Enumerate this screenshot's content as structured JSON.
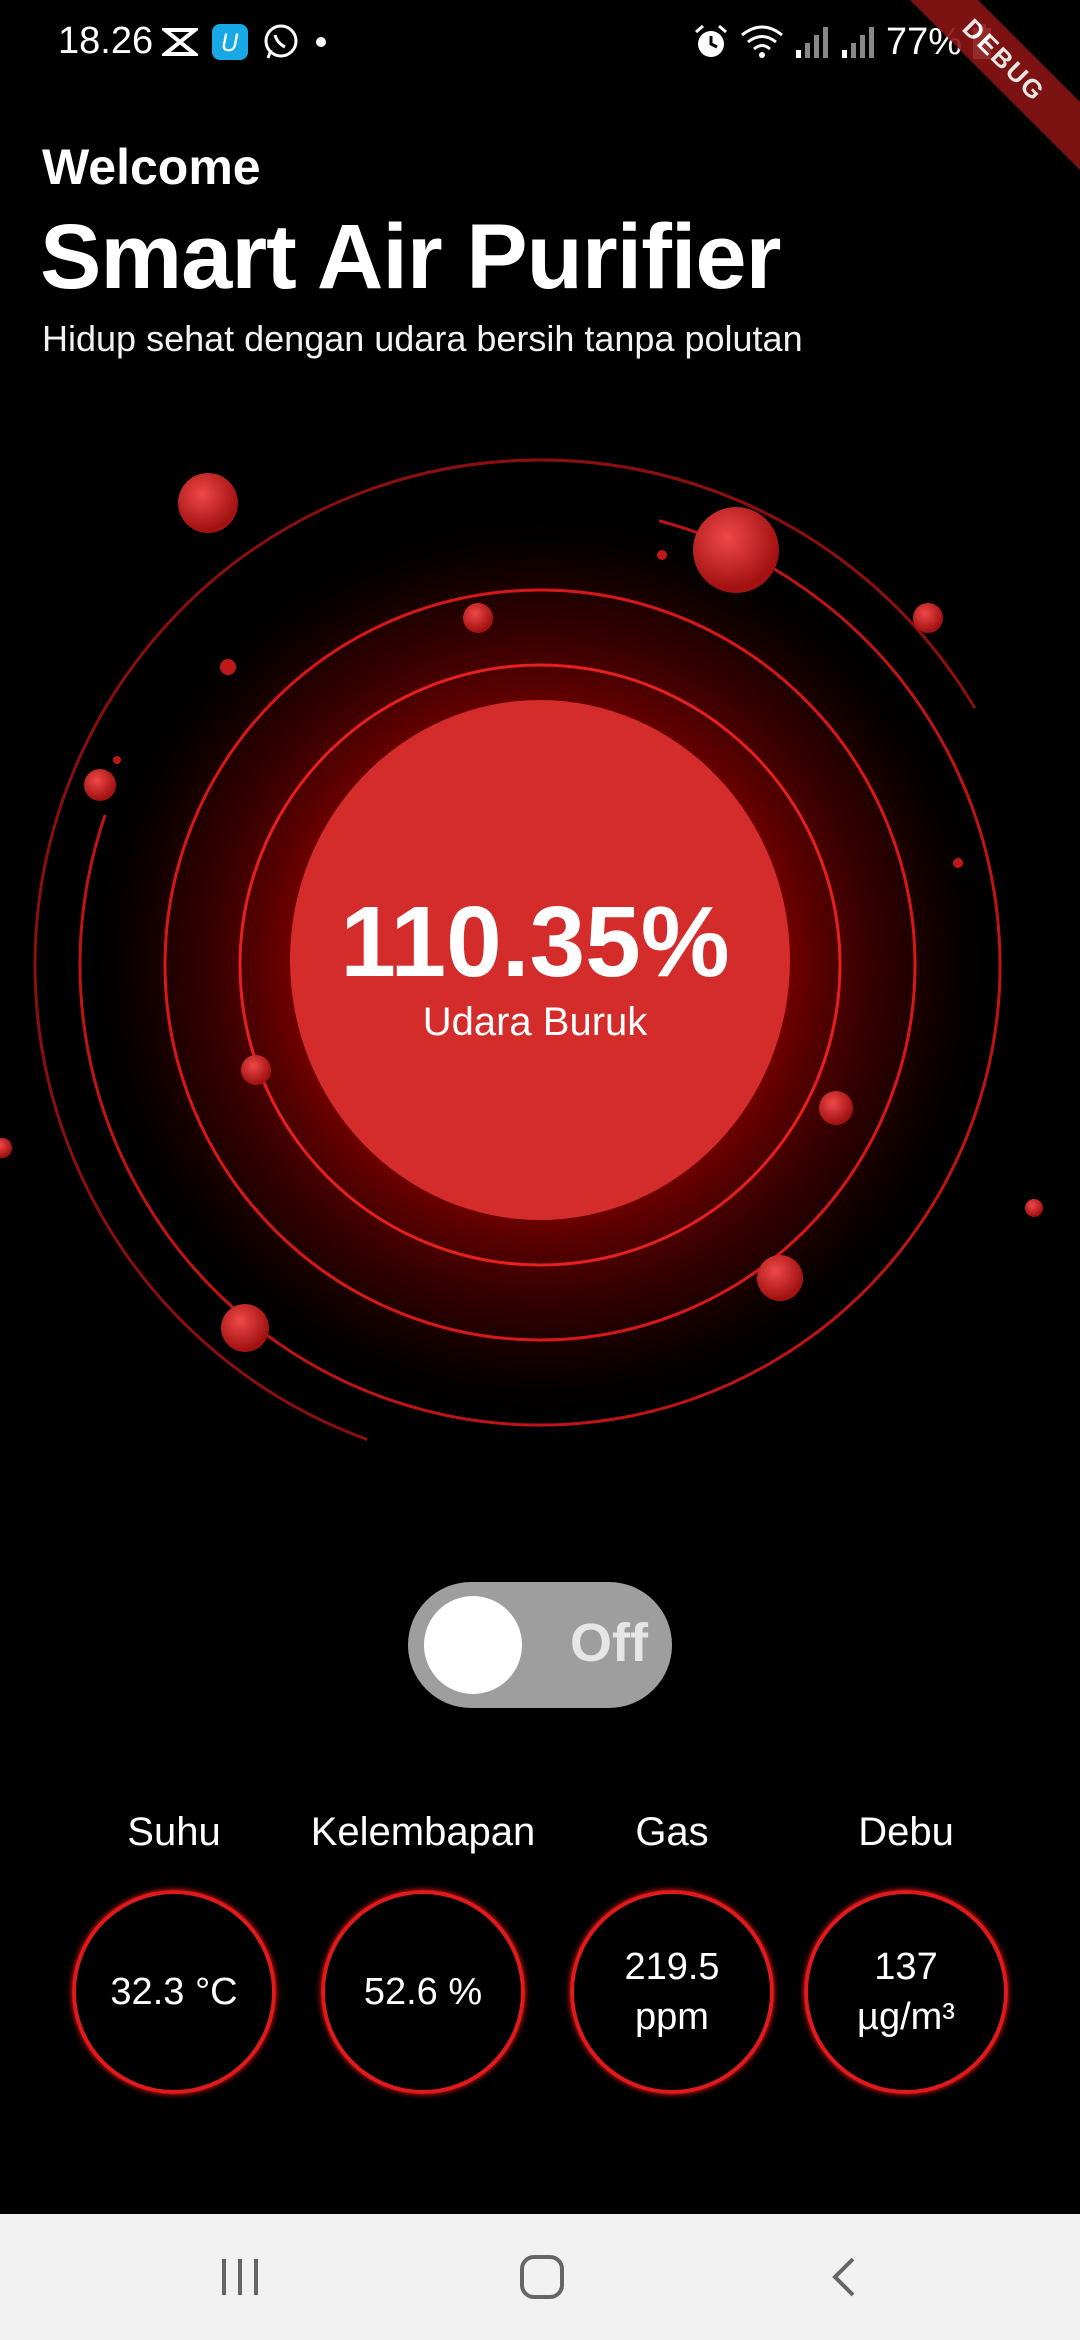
{
  "status_bar": {
    "time": "18.26",
    "battery": "77%",
    "left_icons": [
      "capcut-icon",
      "u-app-icon",
      "whatsapp-icon",
      "dot-icon"
    ],
    "right_icons": [
      "alarm-icon",
      "wifi-icon",
      "signal-icon",
      "signal-icon"
    ]
  },
  "debug_banner": "DEBUG",
  "header": {
    "welcome": "Welcome",
    "title": "Smart Air Purifier",
    "subtitle": "Hidup sehat dengan udara bersih tanpa polutan"
  },
  "gauge": {
    "value": "110.35%",
    "status": "Udara Buruk",
    "accent_color": "#d42b2b"
  },
  "power_toggle": {
    "label": "Off",
    "is_on": false
  },
  "sensors": [
    {
      "label": "Suhu",
      "value": "32.3 °C"
    },
    {
      "label": "Kelembapan",
      "value": "52.6 %"
    },
    {
      "label": "Gas",
      "value": "219.5 ppm"
    },
    {
      "label": "Debu",
      "value": "137 µg/m³"
    }
  ],
  "nav_bar": [
    "recent-apps-icon",
    "home-icon",
    "back-icon"
  ]
}
